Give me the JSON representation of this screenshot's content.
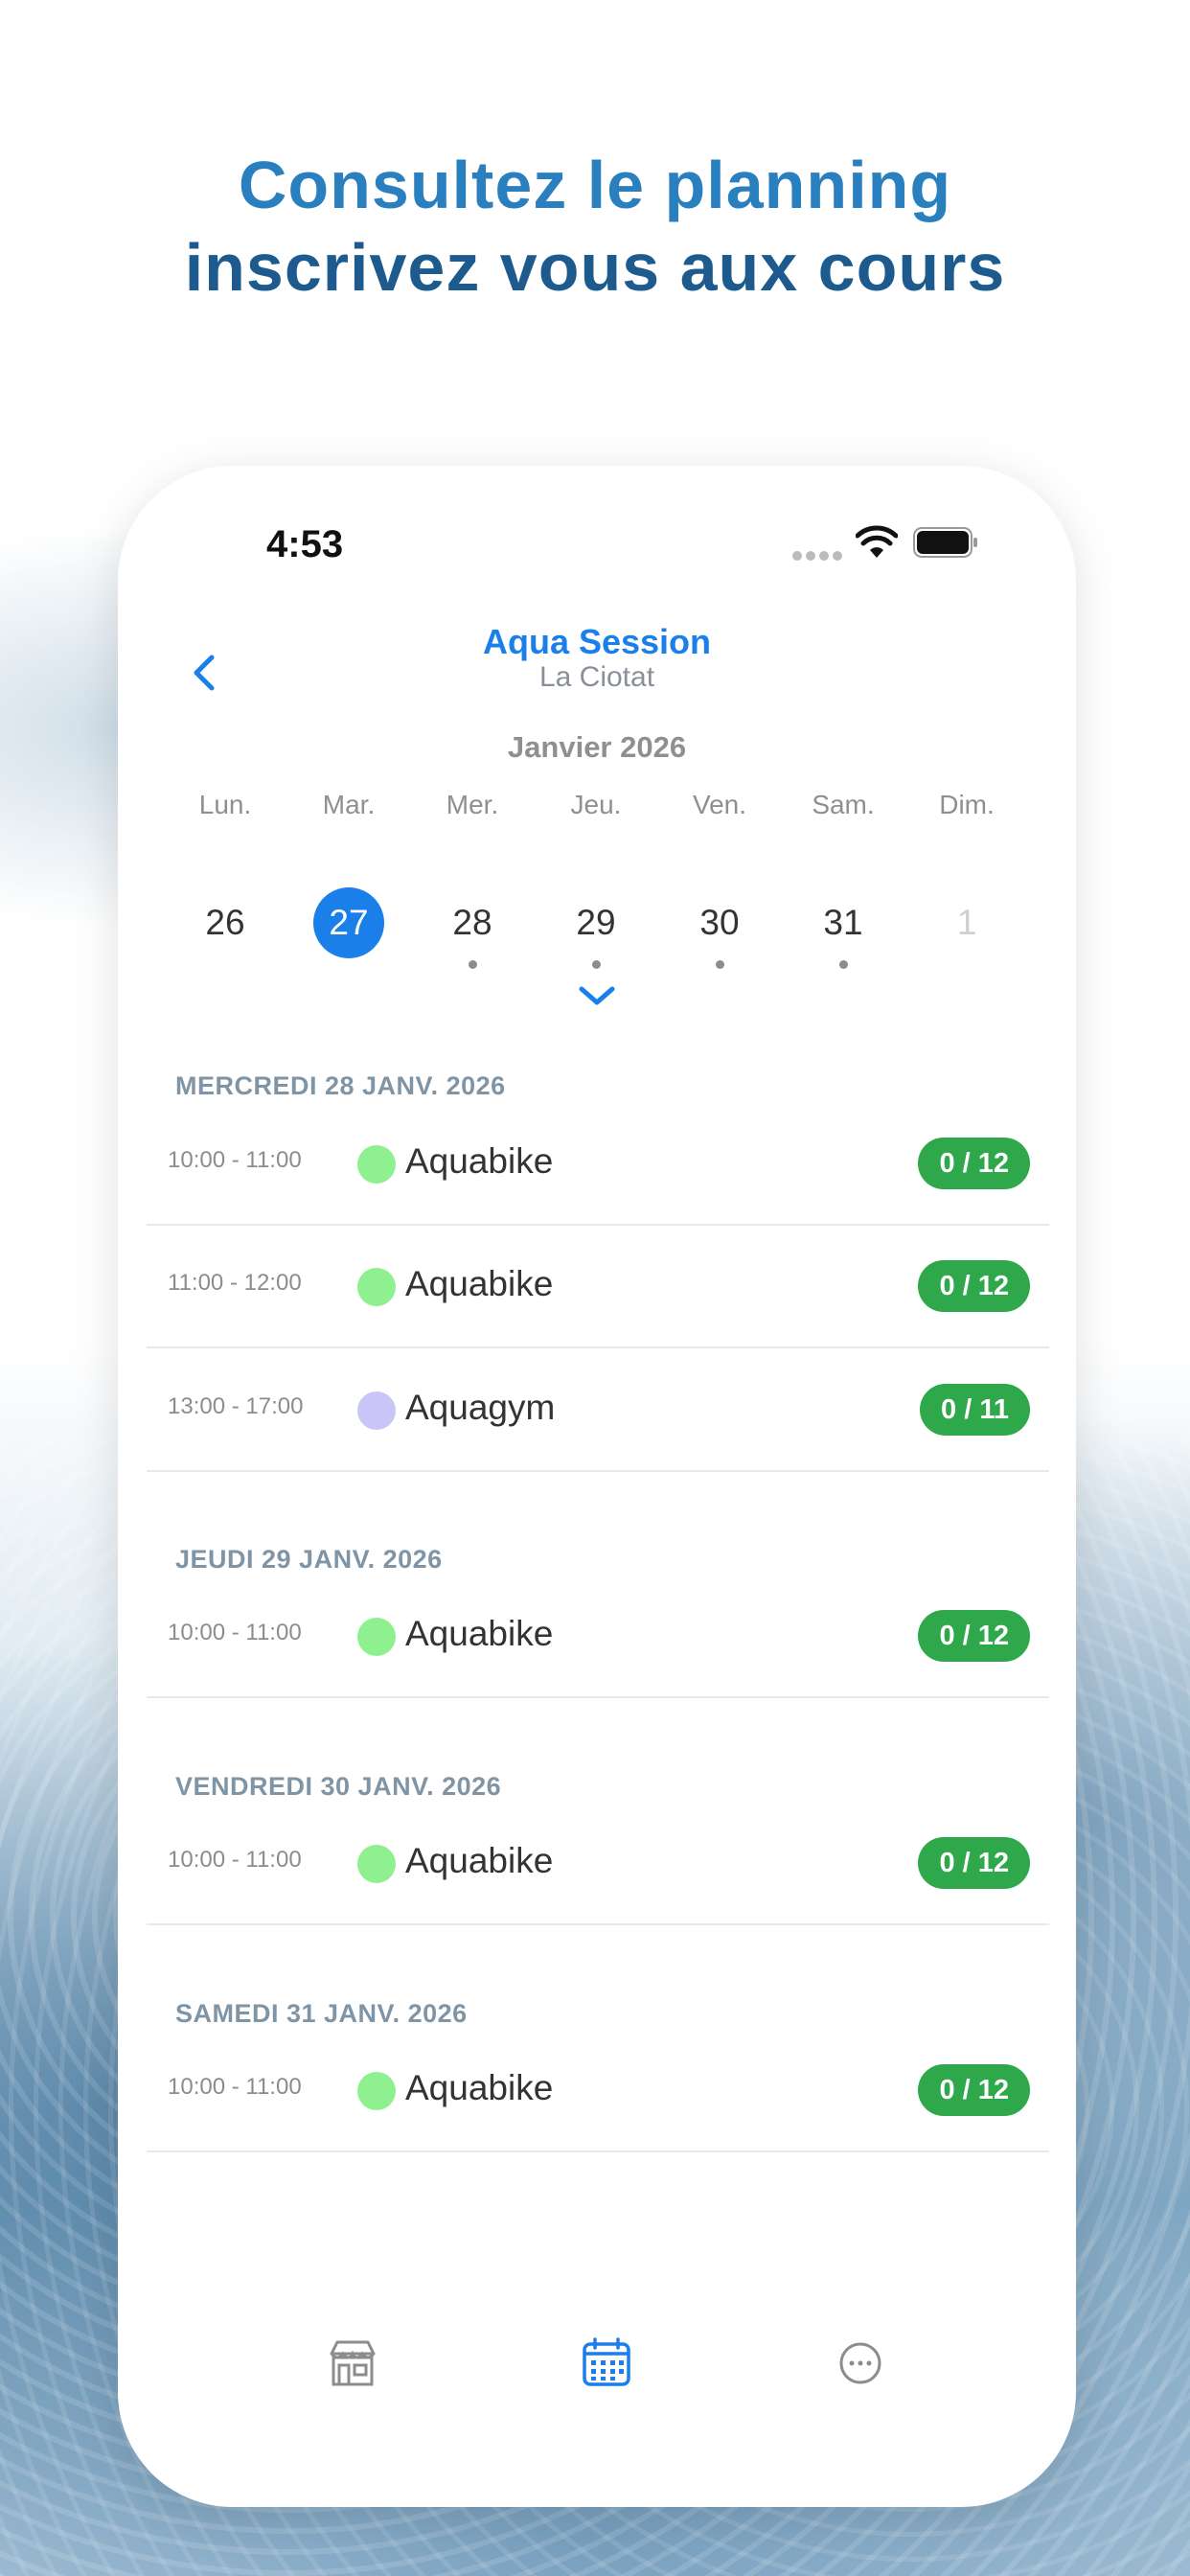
{
  "headline": {
    "line1": "Consultez le planning",
    "line2": "inscrivez vous aux cours"
  },
  "status_bar": {
    "time": "4:53"
  },
  "nav": {
    "title": "Aqua Session",
    "subtitle": "La Ciotat",
    "back_icon": "chevron-left-icon"
  },
  "calendar": {
    "month": "Janvier 2026",
    "weekdays": [
      "Lun.",
      "Mar.",
      "Mer.",
      "Jeu.",
      "Ven.",
      "Sam.",
      "Dim."
    ],
    "days": [
      "26",
      "27",
      "28",
      "29",
      "30",
      "31",
      "1"
    ],
    "selected_day": "27",
    "accent_color": "#1a7fe8"
  },
  "sections": [
    {
      "header": "MERCREDI 28 JANV. 2026",
      "rows": [
        {
          "time": "10:00 - 11:00",
          "name": "Aquabike",
          "badge": "0 / 12",
          "dot_color": "#8ef08e"
        },
        {
          "time": "11:00 - 12:00",
          "name": "Aquabike",
          "badge": "0 / 12",
          "dot_color": "#8ef08e"
        },
        {
          "time": "13:00 - 17:00",
          "name": "Aquagym",
          "badge": "0 / 11",
          "dot_color": "#c9c5f7"
        }
      ]
    },
    {
      "header": "JEUDI 29 JANV. 2026",
      "rows": [
        {
          "time": "10:00 - 11:00",
          "name": "Aquabike",
          "badge": "0 / 12",
          "dot_color": "#8ef08e"
        }
      ]
    },
    {
      "header": "VENDREDI 30 JANV. 2026",
      "rows": [
        {
          "time": "10:00 - 11:00",
          "name": "Aquabike",
          "badge": "0 / 12",
          "dot_color": "#8ef08e"
        }
      ]
    },
    {
      "header": "SAMEDI 31 JANV. 2026",
      "rows": [
        {
          "time": "10:00 - 11:00",
          "name": "Aquabike",
          "badge": "0 / 12",
          "dot_color": "#8ef08e"
        }
      ]
    }
  ],
  "tab_bar": {
    "items": [
      "store-icon",
      "calendar-icon",
      "more-icon"
    ],
    "active": "calendar-icon"
  },
  "colors": {
    "badge_green": "#2ea84a",
    "headline_blue": "#2a7fbf",
    "headline_dark_blue": "#1d5b8f"
  }
}
